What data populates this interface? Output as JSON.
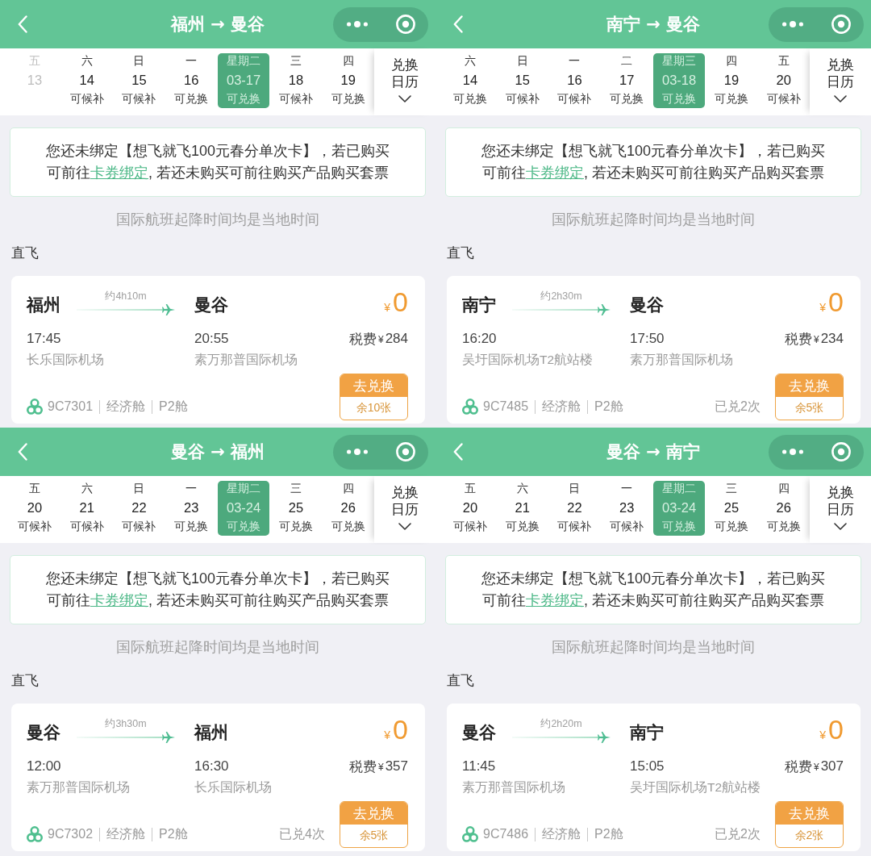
{
  "panels": [
    {
      "title": "福州 → 曼谷",
      "dates": [
        {
          "weekday": "五",
          "date": "13",
          "disabled": true,
          "selected": false
        },
        {
          "weekday": "六",
          "date": "14",
          "status": "可候补",
          "disabled": false,
          "selected": false
        },
        {
          "weekday": "日",
          "date": "15",
          "status": "可候补",
          "disabled": false,
          "selected": false
        },
        {
          "weekday": "一",
          "date": "16",
          "status": "可兑换",
          "disabled": false,
          "selected": false
        },
        {
          "weekday": "星期二",
          "date": "03-17",
          "status": "可兑换",
          "disabled": false,
          "selected": true
        },
        {
          "weekday": "三",
          "date": "18",
          "status": "可候补",
          "disabled": false,
          "selected": false
        },
        {
          "weekday": "四",
          "date": "19",
          "status": "可兑换",
          "disabled": false,
          "selected": false
        }
      ],
      "calendar_button": "兑换日历",
      "notice": {
        "line_1": "您还未绑定【想飞就飞100元春分单次卡】，若已购买",
        "line_2_start": "可前往",
        "link": "卡券绑定",
        "line_2_end": ", 若还未购买可前往购买产品购买套票"
      },
      "timezone_note": "国际航班起降时间均是当地时间",
      "section_label": "直飞",
      "flight": {
        "from_city": "福州",
        "duration": "约4h10m",
        "to_city": "曼谷",
        "currency": "¥",
        "price": "0",
        "depart_time": "17:45",
        "arrive_time": "20:55",
        "tax_label": "税费",
        "tax_currency": "¥",
        "tax": "284",
        "from_airport": "长乐国际机场",
        "to_airport": "素万那普国际机场",
        "flight_number": "9C7301",
        "cabin": "经济舱",
        "fare_class": "P2舱",
        "button_label": "去兑换",
        "remaining": "余10张"
      }
    },
    {
      "title": "南宁 → 曼谷",
      "dates": [
        {
          "weekday": "六",
          "date": "14",
          "status": "可兑换",
          "disabled": false,
          "selected": false
        },
        {
          "weekday": "日",
          "date": "15",
          "status": "可候补",
          "disabled": false,
          "selected": false
        },
        {
          "weekday": "一",
          "date": "16",
          "status": "可候补",
          "disabled": false,
          "selected": false
        },
        {
          "weekday": "二",
          "date": "17",
          "status": "可兑换",
          "disabled": false,
          "selected": false
        },
        {
          "weekday": "星期三",
          "date": "03-18",
          "status": "可兑换",
          "disabled": false,
          "selected": true
        },
        {
          "weekday": "四",
          "date": "19",
          "status": "可兑换",
          "disabled": false,
          "selected": false
        },
        {
          "weekday": "五",
          "date": "20",
          "status": "可候补",
          "disabled": false,
          "selected": false
        }
      ],
      "calendar_button": "兑换日历",
      "notice": {
        "line_1": "您还未绑定【想飞就飞100元春分单次卡】，若已购买",
        "line_2_start": "可前往",
        "link": "卡券绑定",
        "line_2_end": ", 若还未购买可前往购买产品购买套票"
      },
      "timezone_note": "国际航班起降时间均是当地时间",
      "section_label": "直飞",
      "flight": {
        "from_city": "南宁",
        "duration": "约2h30m",
        "to_city": "曼谷",
        "currency": "¥",
        "price": "0",
        "depart_time": "16:20",
        "arrive_time": "17:50",
        "tax_label": "税费",
        "tax_currency": "¥",
        "tax": "234",
        "from_airport": "吴圩国际机场T2航站楼",
        "to_airport": "素万那普国际机场",
        "flight_number": "9C7485",
        "cabin": "经济舱",
        "fare_class": "P2舱",
        "redeemed": "已兑2次",
        "button_label": "去兑换",
        "remaining": "余5张"
      }
    },
    {
      "title": "曼谷 → 福州",
      "dates": [
        {
          "weekday": "五",
          "date": "20",
          "status": "可候补",
          "disabled": false,
          "selected": false
        },
        {
          "weekday": "六",
          "date": "21",
          "status": "可候补",
          "disabled": false,
          "selected": false
        },
        {
          "weekday": "日",
          "date": "22",
          "status": "可候补",
          "disabled": false,
          "selected": false
        },
        {
          "weekday": "一",
          "date": "23",
          "status": "可兑换",
          "disabled": false,
          "selected": false
        },
        {
          "weekday": "星期二",
          "date": "03-24",
          "status": "可兑换",
          "disabled": false,
          "selected": true
        },
        {
          "weekday": "三",
          "date": "25",
          "status": "可兑换",
          "disabled": false,
          "selected": false
        },
        {
          "weekday": "四",
          "date": "26",
          "status": "可兑换",
          "disabled": false,
          "selected": false
        }
      ],
      "calendar_button": "兑换日历",
      "notice": {
        "line_1": "您还未绑定【想飞就飞100元春分单次卡】，若已购买",
        "line_2_start": "可前往",
        "link": "卡券绑定",
        "line_2_end": ", 若还未购买可前往购买产品购买套票"
      },
      "timezone_note": "国际航班起降时间均是当地时间",
      "section_label": "直飞",
      "flight": {
        "from_city": "曼谷",
        "duration": "约3h30m",
        "to_city": "福州",
        "currency": "¥",
        "price": "0",
        "depart_time": "12:00",
        "arrive_time": "16:30",
        "tax_label": "税费",
        "tax_currency": "¥",
        "tax": "357",
        "from_airport": "素万那普国际机场",
        "to_airport": "长乐国际机场",
        "flight_number": "9C7302",
        "cabin": "经济舱",
        "fare_class": "P2舱",
        "redeemed": "已兑4次",
        "button_label": "去兑换",
        "remaining": "余5张"
      }
    },
    {
      "title": "曼谷 → 南宁",
      "dates": [
        {
          "weekday": "五",
          "date": "20",
          "status": "可候补",
          "disabled": false,
          "selected": false
        },
        {
          "weekday": "六",
          "date": "21",
          "status": "可兑换",
          "disabled": false,
          "selected": false
        },
        {
          "weekday": "日",
          "date": "22",
          "status": "可候补",
          "disabled": false,
          "selected": false
        },
        {
          "weekday": "一",
          "date": "23",
          "status": "可候补",
          "disabled": false,
          "selected": false
        },
        {
          "weekday": "星期二",
          "date": "03-24",
          "status": "可兑换",
          "disabled": false,
          "selected": true
        },
        {
          "weekday": "三",
          "date": "25",
          "status": "可兑换",
          "disabled": false,
          "selected": false
        },
        {
          "weekday": "四",
          "date": "26",
          "status": "可兑换",
          "disabled": false,
          "selected": false
        }
      ],
      "calendar_button": "兑换日历",
      "notice": {
        "line_1": "您还未绑定【想飞就飞100元春分单次卡】，若已购买",
        "line_2_start": "可前往",
        "link": "卡券绑定",
        "line_2_end": ", 若还未购买可前往购买产品购买套票"
      },
      "timezone_note": "国际航班起降时间均是当地时间",
      "section_label": "直飞",
      "flight": {
        "from_city": "曼谷",
        "duration": "约2h20m",
        "to_city": "南宁",
        "currency": "¥",
        "price": "0",
        "depart_time": "11:45",
        "arrive_time": "15:05",
        "tax_label": "税费",
        "tax_currency": "¥",
        "tax": "307",
        "from_airport": "素万那普国际机场",
        "to_airport": "吴圩国际机场T2航站楼",
        "flight_number": "9C7486",
        "cabin": "经济舱",
        "fare_class": "P2舱",
        "redeemed": "已兑2次",
        "button_label": "去兑换",
        "remaining": "余2张"
      }
    }
  ]
}
